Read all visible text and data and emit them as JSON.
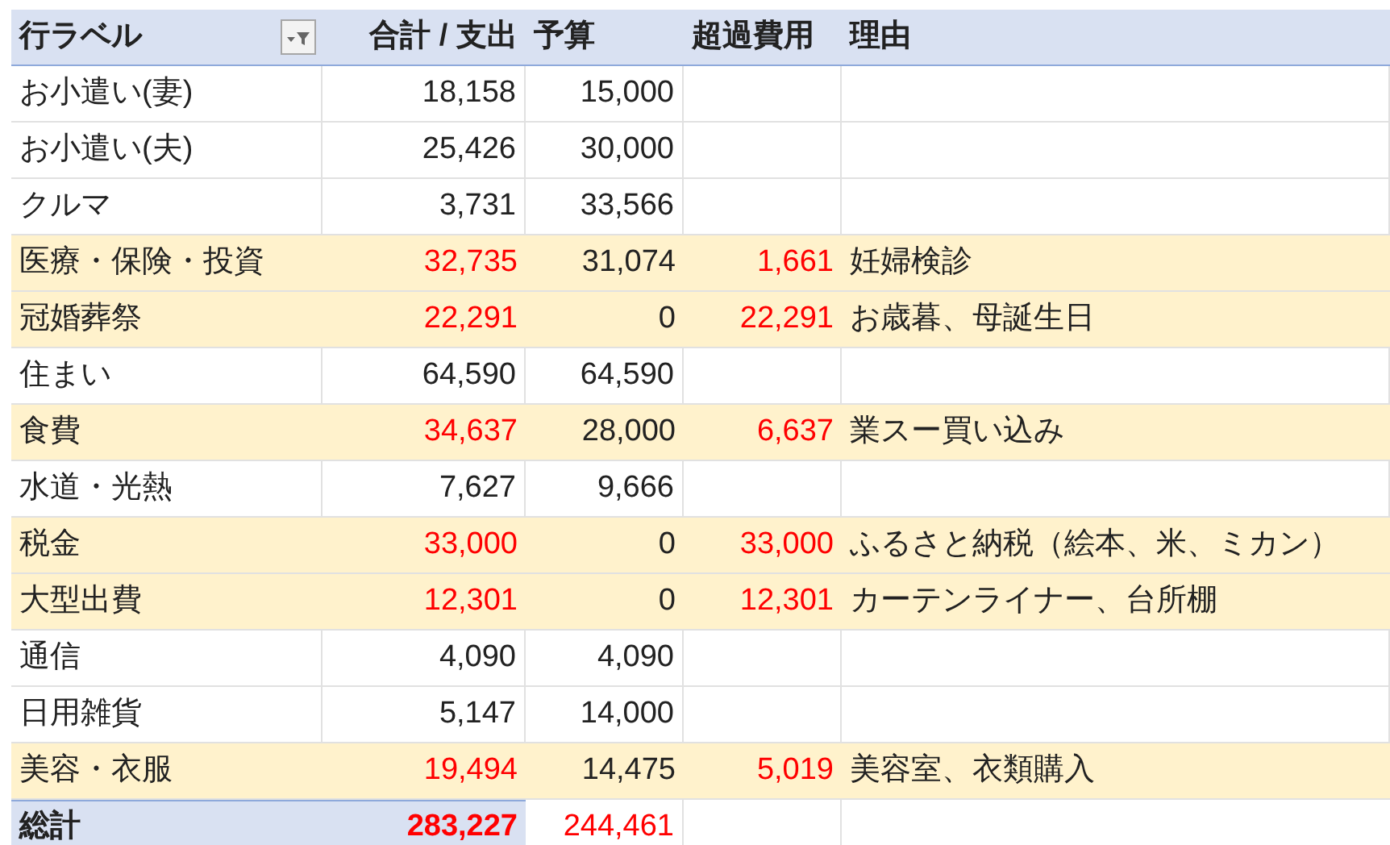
{
  "header": {
    "row_label": "行ラベル",
    "sum": "合計 / 支出",
    "budget": "予算",
    "excess": "超過費用",
    "reason": "理由"
  },
  "rows": [
    {
      "label": "お小遣い(妻)",
      "sum": "18,158",
      "budget": "15,000",
      "over": false
    },
    {
      "label": "お小遣い(夫)",
      "sum": "25,426",
      "budget": "30,000",
      "over": false
    },
    {
      "label": "クルマ",
      "sum": "3,731",
      "budget": "33,566",
      "over": false
    },
    {
      "label": "医療・保険・投資",
      "sum": "32,735",
      "budget": "31,074",
      "excess": "1,661",
      "reason": "妊婦検診",
      "over": true
    },
    {
      "label": "冠婚葬祭",
      "sum": "22,291",
      "budget": "0",
      "excess": "22,291",
      "reason": "お歳暮、母誕生日",
      "over": true
    },
    {
      "label": "住まい",
      "sum": "64,590",
      "budget": "64,590",
      "over": false
    },
    {
      "label": "食費",
      "sum": "34,637",
      "budget": "28,000",
      "excess": "6,637",
      "reason": "業スー買い込み",
      "over": true
    },
    {
      "label": "水道・光熱",
      "sum": "7,627",
      "budget": "9,666",
      "over": false
    },
    {
      "label": "税金",
      "sum": "33,000",
      "budget": "0",
      "excess": "33,000",
      "reason": "ふるさと納税（絵本、米、ミカン）",
      "over": true
    },
    {
      "label": "大型出費",
      "sum": "12,301",
      "budget": "0",
      "excess": "12,301",
      "reason": "カーテンライナー、台所棚",
      "over": true
    },
    {
      "label": "通信",
      "sum": "4,090",
      "budget": "4,090",
      "over": false
    },
    {
      "label": "日用雑貨",
      "sum": "5,147",
      "budget": "14,000",
      "over": false
    },
    {
      "label": "美容・衣服",
      "sum": "19,494",
      "budget": "14,475",
      "excess": "5,019",
      "reason": "美容室、衣類購入",
      "over": true
    }
  ],
  "total": {
    "label": "総計",
    "sum": "283,227",
    "budget": "244,461"
  }
}
